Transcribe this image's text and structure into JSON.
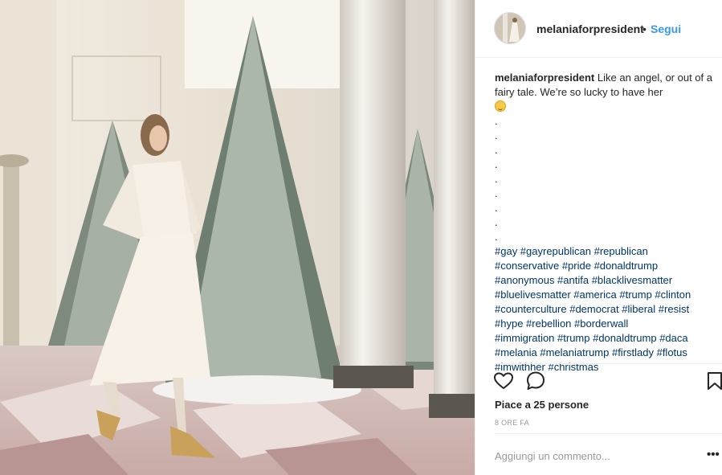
{
  "post": {
    "username": "melaniaforpresident",
    "separator": "•",
    "follow_label": "Segui",
    "caption_text": "Like an angel, or out of a fairy tale. We’re so lucky to have her",
    "caption_dots": [
      ".",
      ".",
      ".",
      ".",
      ".",
      ".",
      ".",
      ".",
      "."
    ],
    "hashtag_lines": [
      "#gay #gayrepublican #republican",
      "#conservative #pride #donaldtrump",
      "#anonymous #antifa #blacklivesmatter",
      "#bluelivesmatter #america #trump #clinton",
      "#counterculture #democrat #liberal #resist",
      "#hype #rebellion #borderwall",
      "#immigration #trump #donaldtrump #daca",
      "#melania #melaniatrump #firstlady #flotus",
      "#imwithher #christmas"
    ],
    "likes_text": "Piace a 25 persone",
    "time_text": "8 ORE FA",
    "comment_placeholder": "Aggiungi un commento...",
    "more_label": "•••"
  },
  "icons": {
    "like": "heart-icon",
    "comment": "comment-bubble-icon",
    "save": "bookmark-icon",
    "more": "more-options-icon"
  },
  "colors": {
    "link_blue": "#3897f0",
    "hashtag": "#003569",
    "text": "#262626",
    "muted": "#999999"
  }
}
